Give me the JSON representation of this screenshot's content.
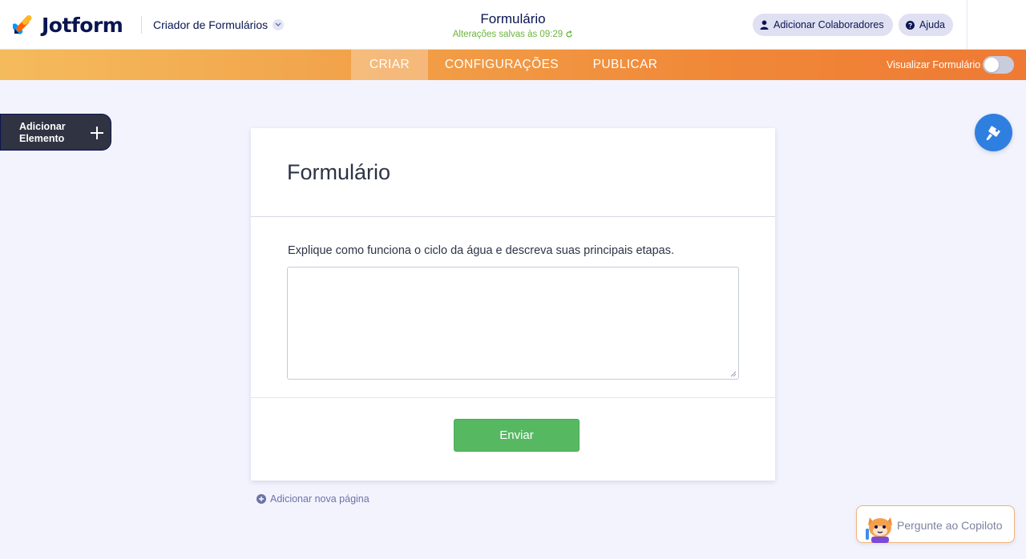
{
  "header": {
    "brand": "Jotform",
    "builder_menu": "Criador de Formulários",
    "form_title": "Formulário",
    "saved_status": "Alterações salvas às 09:29",
    "collab_button": "Adicionar Colaboradores",
    "help_button": "Ajuda"
  },
  "nav": {
    "tabs": [
      "CRIAR",
      "CONFIGURAÇÕES",
      "PUBLICAR"
    ],
    "active_tab": "CRIAR",
    "preview_label": "Visualizar Formulário",
    "preview_on": false
  },
  "sidebar": {
    "add_element": "Adicionar Elemento"
  },
  "form": {
    "title": "Formulário",
    "question": "Explique como funciona o ciclo da água e descreva suas principais etapas.",
    "answer_value": "",
    "submit": "Enviar"
  },
  "footer": {
    "add_page": "Adicionar nova página",
    "copilot": "Pergunte ao Copiloto"
  },
  "colors": {
    "nav_gradient_start": "#f4bb5c",
    "nav_gradient_end": "#ef7a34",
    "submit_green": "#57b862",
    "designer_blue": "#2f7fe0",
    "saved_green": "#6bb53d"
  },
  "icons": {
    "logo": "jotform-logo-icon",
    "builder_chevron": "chevron-down-icon",
    "saved": "refresh-icon",
    "collab": "user-icon",
    "help": "question-circle-icon",
    "add_element": "plus-icon",
    "designer": "paint-roller-icon",
    "add_page": "plus-circle-icon",
    "copilot": "copilot-avatar-icon"
  }
}
